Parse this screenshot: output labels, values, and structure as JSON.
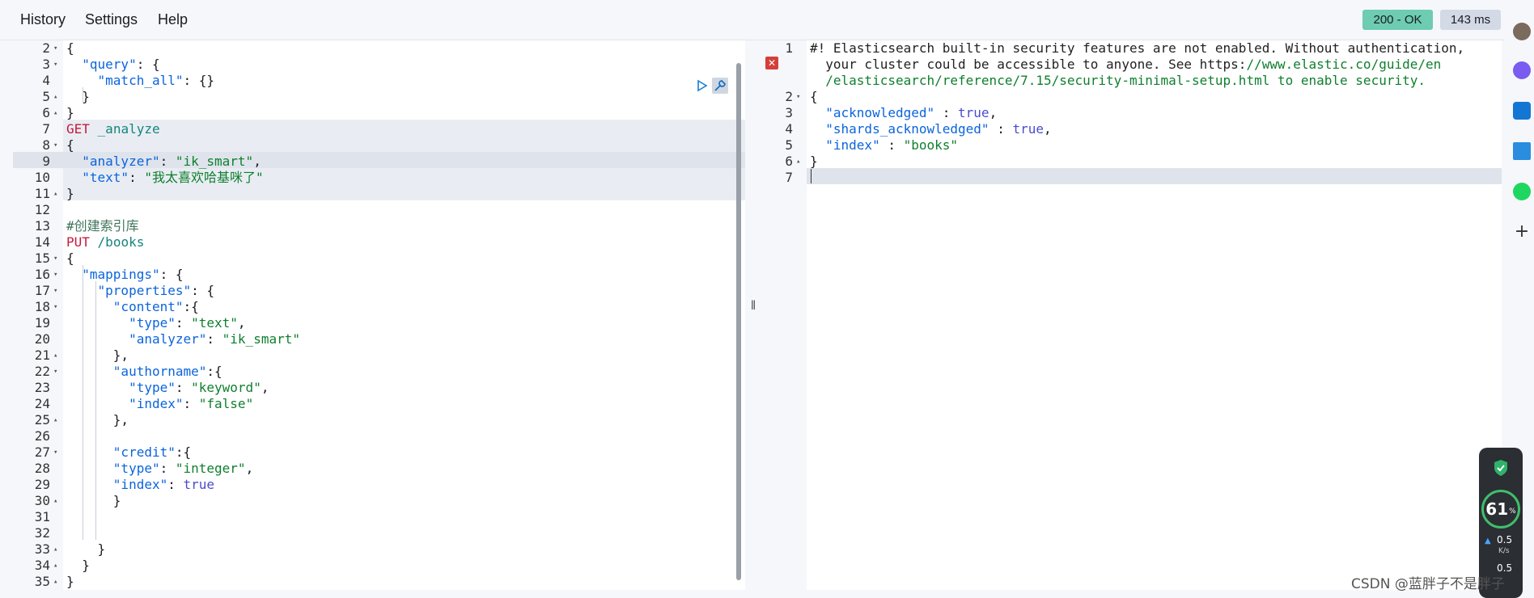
{
  "menu": {
    "history": "History",
    "settings": "Settings",
    "help": "Help"
  },
  "status": {
    "code": "200 - OK",
    "time": "143 ms"
  },
  "left_editor": {
    "lines": [
      {
        "n": "2",
        "fold": "▾"
      },
      {
        "n": "3",
        "fold": "▾"
      },
      {
        "n": "4",
        "fold": ""
      },
      {
        "n": "5",
        "fold": "▴"
      },
      {
        "n": "6",
        "fold": "▴"
      },
      {
        "n": "7",
        "fold": ""
      },
      {
        "n": "8",
        "fold": "▾"
      },
      {
        "n": "9",
        "fold": ""
      },
      {
        "n": "10",
        "fold": ""
      },
      {
        "n": "11",
        "fold": "▴"
      },
      {
        "n": "12",
        "fold": ""
      },
      {
        "n": "13",
        "fold": ""
      },
      {
        "n": "14",
        "fold": ""
      },
      {
        "n": "15",
        "fold": "▾"
      },
      {
        "n": "16",
        "fold": "▾"
      },
      {
        "n": "17",
        "fold": "▾"
      },
      {
        "n": "18",
        "fold": "▾"
      },
      {
        "n": "19",
        "fold": ""
      },
      {
        "n": "20",
        "fold": ""
      },
      {
        "n": "21",
        "fold": "▴"
      },
      {
        "n": "22",
        "fold": "▾"
      },
      {
        "n": "23",
        "fold": ""
      },
      {
        "n": "24",
        "fold": ""
      },
      {
        "n": "25",
        "fold": "▴"
      },
      {
        "n": "26",
        "fold": ""
      },
      {
        "n": "27",
        "fold": "▾"
      },
      {
        "n": "28",
        "fold": ""
      },
      {
        "n": "29",
        "fold": ""
      },
      {
        "n": "30",
        "fold": "▴"
      },
      {
        "n": "31",
        "fold": ""
      },
      {
        "n": "32",
        "fold": ""
      },
      {
        "n": "33",
        "fold": "▴"
      },
      {
        "n": "34",
        "fold": "▴"
      },
      {
        "n": "35",
        "fold": "▴"
      }
    ],
    "code": [
      [
        [
          "punc",
          "{"
        ]
      ],
      [
        [
          "punc",
          "  "
        ],
        [
          "key",
          "\"query\""
        ],
        [
          "punc",
          ": {"
        ]
      ],
      [
        [
          "punc",
          "    "
        ],
        [
          "key",
          "\"match_all\""
        ],
        [
          "punc",
          ": {}"
        ]
      ],
      [
        [
          "punc",
          "  }"
        ]
      ],
      [
        [
          "punc",
          "}"
        ]
      ],
      [
        [
          "method",
          "GET"
        ],
        [
          "punc",
          " "
        ],
        [
          "path",
          "_analyze"
        ]
      ],
      [
        [
          "punc",
          "{"
        ]
      ],
      [
        [
          "punc",
          "  "
        ],
        [
          "key",
          "\"analyzer\""
        ],
        [
          "punc",
          ": "
        ],
        [
          "str",
          "\"ik_smart\""
        ],
        [
          "punc",
          ","
        ]
      ],
      [
        [
          "punc",
          "  "
        ],
        [
          "key",
          "\"text\""
        ],
        [
          "punc",
          ": "
        ],
        [
          "str",
          "\"我太喜欢哈基咪了\""
        ]
      ],
      [
        [
          "punc",
          "}"
        ]
      ],
      [],
      [
        [
          "comment",
          "#创建索引库"
        ]
      ],
      [
        [
          "method",
          "PUT"
        ],
        [
          "punc",
          " "
        ],
        [
          "path",
          "/books"
        ]
      ],
      [
        [
          "punc",
          "{"
        ]
      ],
      [
        [
          "punc",
          "  "
        ],
        [
          "key",
          "\"mappings\""
        ],
        [
          "punc",
          ": {"
        ]
      ],
      [
        [
          "punc",
          "    "
        ],
        [
          "key",
          "\"properties\""
        ],
        [
          "punc",
          ": {"
        ]
      ],
      [
        [
          "punc",
          "      "
        ],
        [
          "key",
          "\"content\""
        ],
        [
          "punc",
          ":{"
        ]
      ],
      [
        [
          "punc",
          "        "
        ],
        [
          "key",
          "\"type\""
        ],
        [
          "punc",
          ": "
        ],
        [
          "str",
          "\"text\""
        ],
        [
          "punc",
          ","
        ]
      ],
      [
        [
          "punc",
          "        "
        ],
        [
          "key",
          "\"analyzer\""
        ],
        [
          "punc",
          ": "
        ],
        [
          "str",
          "\"ik_smart\""
        ]
      ],
      [
        [
          "punc",
          "      },"
        ]
      ],
      [
        [
          "punc",
          "      "
        ],
        [
          "key",
          "\"authorname\""
        ],
        [
          "punc",
          ":{"
        ]
      ],
      [
        [
          "punc",
          "        "
        ],
        [
          "key",
          "\"type\""
        ],
        [
          "punc",
          ": "
        ],
        [
          "str",
          "\"keyword\""
        ],
        [
          "punc",
          ","
        ]
      ],
      [
        [
          "punc",
          "        "
        ],
        [
          "key",
          "\"index\""
        ],
        [
          "punc",
          ": "
        ],
        [
          "str",
          "\"false\""
        ]
      ],
      [
        [
          "punc",
          "      },"
        ]
      ],
      [],
      [
        [
          "punc",
          "      "
        ],
        [
          "key",
          "\"credit\""
        ],
        [
          "punc",
          ":{"
        ]
      ],
      [
        [
          "punc",
          "      "
        ],
        [
          "key",
          "\"type\""
        ],
        [
          "punc",
          ": "
        ],
        [
          "str",
          "\"integer\""
        ],
        [
          "punc",
          ","
        ]
      ],
      [
        [
          "punc",
          "      "
        ],
        [
          "key",
          "\"index\""
        ],
        [
          "punc",
          ": "
        ],
        [
          "bool",
          "true"
        ]
      ],
      [
        [
          "punc",
          "      }"
        ]
      ],
      [],
      [],
      [
        [
          "punc",
          "    }"
        ]
      ],
      [
        [
          "punc",
          "  }"
        ]
      ],
      [
        [
          "punc",
          "}"
        ]
      ]
    ]
  },
  "right_editor": {
    "lines": [
      {
        "n": "1",
        "fold": ""
      },
      {
        "n": "",
        "fold": ""
      },
      {
        "n": "",
        "fold": ""
      },
      {
        "n": "2",
        "fold": "▾"
      },
      {
        "n": "3",
        "fold": ""
      },
      {
        "n": "4",
        "fold": ""
      },
      {
        "n": "5",
        "fold": ""
      },
      {
        "n": "6",
        "fold": "▴"
      },
      {
        "n": "7",
        "fold": ""
      }
    ],
    "code": [
      [
        [
          "warn",
          "#! Elasticsearch built-in security features are not enabled. Without authentication,"
        ]
      ],
      [
        [
          "warn",
          "  your cluster could be accessible to anyone. See https:"
        ],
        [
          "link",
          "//www.elastic.co/guide/en"
        ]
      ],
      [
        [
          "link",
          "  /elasticsearch/reference/7.15/security-minimal-setup.html to enable security."
        ]
      ],
      [
        [
          "punc",
          "{"
        ]
      ],
      [
        [
          "punc",
          "  "
        ],
        [
          "key",
          "\"acknowledged\""
        ],
        [
          "punc",
          " : "
        ],
        [
          "bool",
          "true"
        ],
        [
          "punc",
          ","
        ]
      ],
      [
        [
          "punc",
          "  "
        ],
        [
          "key",
          "\"shards_acknowledged\""
        ],
        [
          "punc",
          " : "
        ],
        [
          "bool",
          "true"
        ],
        [
          "punc",
          ","
        ]
      ],
      [
        [
          "punc",
          "  "
        ],
        [
          "key",
          "\"index\""
        ],
        [
          "punc",
          " : "
        ],
        [
          "str",
          "\"books\""
        ]
      ],
      [
        [
          "punc",
          "}"
        ]
      ],
      []
    ]
  },
  "widget": {
    "percent": "61",
    "percent_sign": "%",
    "up": "0.5",
    "unit": "K/s",
    "down": "0.5"
  },
  "watermark": "CSDN @蓝胖子不是胖子",
  "resizer_glyph": "‖",
  "error_glyph": "✕",
  "colors": {
    "ok": "#6dccb1",
    "time": "#d3dae6",
    "error": "#d43f3a"
  }
}
